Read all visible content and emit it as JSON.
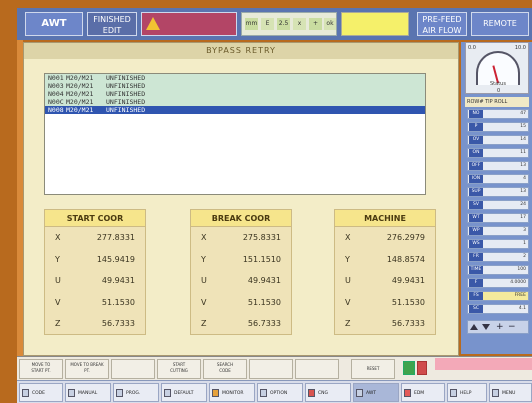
{
  "top_bar": {
    "mode": "AWT",
    "status_line1": "FINISHED",
    "status_line2": "EDIT",
    "status_icons": [
      "mm",
      "E",
      "2.5",
      "x",
      "+",
      "ok"
    ],
    "right_btn1_line1": "PRE-FEED",
    "right_btn1_line2": "AIR FLOW",
    "right_btn2": "REMOTE"
  },
  "bypass_retry": {
    "title": "BYPASS RETRY",
    "list": [
      {
        "col1": "N001",
        "col2": "M20/M21",
        "col3": "UNFINISHED"
      },
      {
        "col1": "N003",
        "col2": "M20/M21",
        "col3": "UNFINISHED"
      },
      {
        "col1": "N004",
        "col2": "M20/M21",
        "col3": "UNFINISHED"
      },
      {
        "col1": "N00C",
        "col2": "M20/M21",
        "col3": "UNFINISHED"
      },
      {
        "col1": "N008",
        "col2": "M20/M21",
        "col3": "UNFINISHED"
      }
    ],
    "start_coor": {
      "title": "START COOR",
      "rows": [
        {
          "axis": "X",
          "value": "277.8331"
        },
        {
          "axis": "Y",
          "value": "145.9419"
        },
        {
          "axis": "U",
          "value": "49.9431"
        },
        {
          "axis": "V",
          "value": "51.1530"
        },
        {
          "axis": "Z",
          "value": "56.7333"
        }
      ]
    },
    "break_coor": {
      "title": "BREAK COOR",
      "rows": [
        {
          "axis": "X",
          "value": "275.8331"
        },
        {
          "axis": "Y",
          "value": "151.1510"
        },
        {
          "axis": "U",
          "value": "49.9431"
        },
        {
          "axis": "V",
          "value": "51.1530"
        },
        {
          "axis": "Z",
          "value": "56.7333"
        }
      ]
    },
    "machine": {
      "title": "MACHINE",
      "rows": [
        {
          "axis": "X",
          "value": "276.2979"
        },
        {
          "axis": "Y",
          "value": "148.8574"
        },
        {
          "axis": "U",
          "value": "49.9431"
        },
        {
          "axis": "V",
          "value": "51.1530"
        },
        {
          "axis": "Z",
          "value": "56.7333"
        }
      ]
    }
  },
  "right_panel": {
    "gauge_left": "0.0",
    "gauge_right": "10.0",
    "gauge_mid": "Status",
    "gauge_low": "0",
    "header": "ROW# TIP ROLL",
    "rows": [
      {
        "key": "NO",
        "value": "47"
      },
      {
        "key": "P",
        "value": "15"
      },
      {
        "key": "OV",
        "value": "14"
      },
      {
        "key": "ON",
        "value": "11"
      },
      {
        "key": "OFF",
        "value": "13"
      },
      {
        "key": "ION",
        "value": "4"
      },
      {
        "key": "SUP",
        "value": "13"
      },
      {
        "key": "SV",
        "value": "24"
      },
      {
        "key": "WT",
        "value": "17"
      },
      {
        "key": "WP",
        "value": "3"
      },
      {
        "key": "WS",
        "value": "1"
      },
      {
        "key": "FR",
        "value": "2"
      },
      {
        "key": "TIME",
        "value": "100"
      },
      {
        "key": "F",
        "value": "4.0000"
      },
      {
        "key": "FS",
        "value": "FREE"
      },
      {
        "key": "SC",
        "value": "4.1"
      }
    ]
  },
  "bottom_bar_1": {
    "buttons": [
      {
        "line1": "MOVE TO",
        "line2": "START PT."
      },
      {
        "line1": "MOVE TO BREAK",
        "line2": "PT."
      },
      {
        "line1": "",
        "line2": ""
      },
      {
        "line1": "START",
        "line2": "CUTTING"
      },
      {
        "line1": "SEARCH",
        "line2": "CODE"
      },
      {
        "line1": "",
        "line2": ""
      },
      {
        "line1": "",
        "line2": ""
      },
      {
        "line1": "RESET",
        "line2": ""
      }
    ]
  },
  "bottom_bar_2": {
    "buttons": [
      "CODE",
      "MANUAL",
      "PROG.",
      "DEFAULT",
      "MONITOR",
      "OPTION",
      "CNG",
      "AWT",
      "EDM",
      "HELP",
      "MENU"
    ]
  }
}
